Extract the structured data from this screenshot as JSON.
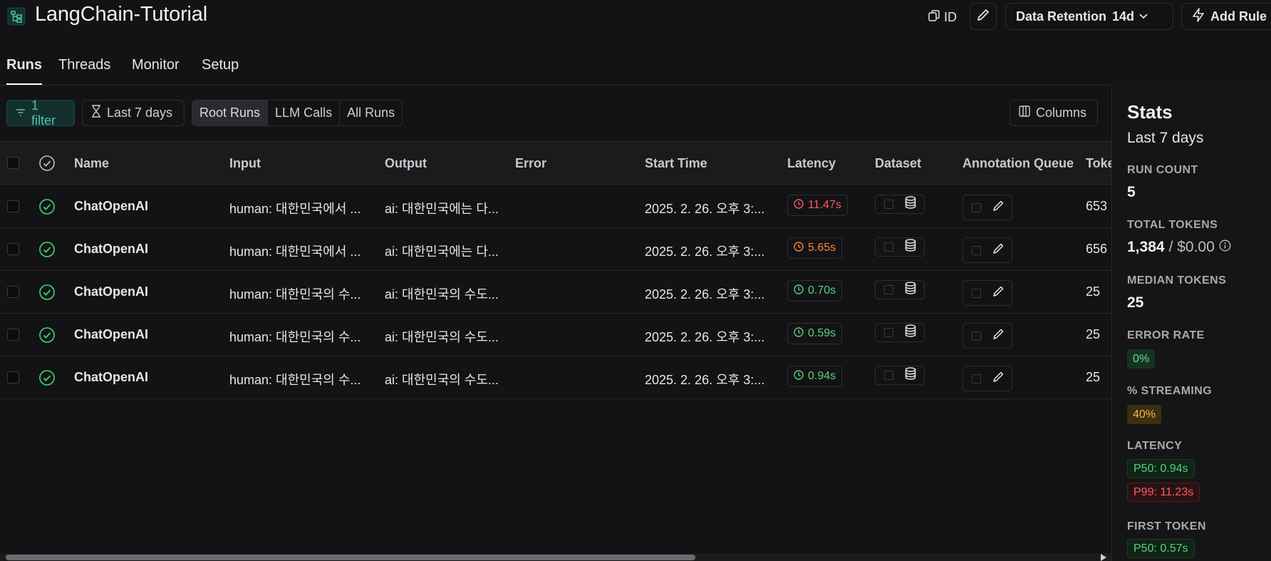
{
  "header": {
    "project_icon": "project-tree-icon",
    "title": "LangChain-Tutorial",
    "id_label": "ID",
    "retention_label": "Data Retention",
    "retention_value": "14d",
    "add_rule_label": "Add Rule"
  },
  "tabs": [
    {
      "label": "Runs",
      "active": true
    },
    {
      "label": "Threads",
      "active": false
    },
    {
      "label": "Monitor",
      "active": false
    },
    {
      "label": "Setup",
      "active": false
    }
  ],
  "toolbar": {
    "filter_label": "1 filter",
    "time_label": "Last 7 days",
    "segments": [
      "Root Runs",
      "LLM Calls",
      "All Runs"
    ],
    "active_segment": "Root Runs",
    "columns_label": "Columns"
  },
  "table": {
    "headers": [
      "Name",
      "Input",
      "Output",
      "Error",
      "Start Time",
      "Latency",
      "Dataset",
      "Annotation Queue",
      "Toke"
    ],
    "rows": [
      {
        "name": "ChatOpenAI",
        "input": "human: 대한민국에서 ...",
        "output": "ai: 대한민국에는 다...",
        "error": "",
        "start": "2025. 2. 26. 오후 3:...",
        "latency": "11.47s",
        "latency_color": "#ff5866",
        "tokens": "653"
      },
      {
        "name": "ChatOpenAI",
        "input": "human: 대한민국에서 ...",
        "output": "ai: 대한민국에는 다...",
        "error": "",
        "start": "2025. 2. 26. 오후 3:...",
        "latency": "5.65s",
        "latency_color": "#f5873a",
        "tokens": "656"
      },
      {
        "name": "ChatOpenAI",
        "input": "human: 대한민국의 수...",
        "output": "ai: 대한민국의 수도...",
        "error": "",
        "start": "2025. 2. 26. 오후 3:...",
        "latency": "0.70s",
        "latency_color": "#58d17b",
        "tokens": "25"
      },
      {
        "name": "ChatOpenAI",
        "input": "human: 대한민국의 수...",
        "output": "ai: 대한민국의 수도...",
        "error": "",
        "start": "2025. 2. 26. 오후 3:...",
        "latency": "0.59s",
        "latency_color": "#58d17b",
        "tokens": "25"
      },
      {
        "name": "ChatOpenAI",
        "input": "human: 대한민국의 수...",
        "output": "ai: 대한민국의 수도...",
        "error": "",
        "start": "2025. 2. 26. 오후 3:...",
        "latency": "0.94s",
        "latency_color": "#58d17b",
        "tokens": "25"
      }
    ]
  },
  "stats": {
    "title": "Stats",
    "subtitle": "Last 7 days",
    "run_count_label": "RUN COUNT",
    "run_count": "5",
    "total_tokens_label": "TOTAL TOKENS",
    "total_tokens": "1,384",
    "total_cost": "/ $0.00",
    "median_tokens_label": "MEDIAN TOKENS",
    "median_tokens": "25",
    "error_rate_label": "ERROR RATE",
    "error_rate": "0%",
    "streaming_label": "% STREAMING",
    "streaming": "40%",
    "latency_label": "LATENCY",
    "latency_p50": "P50: 0.94s",
    "latency_p99": "P99: 11.23s",
    "first_token_label": "FIRST TOKEN",
    "first_token_p50": "P50: 0.57s"
  }
}
